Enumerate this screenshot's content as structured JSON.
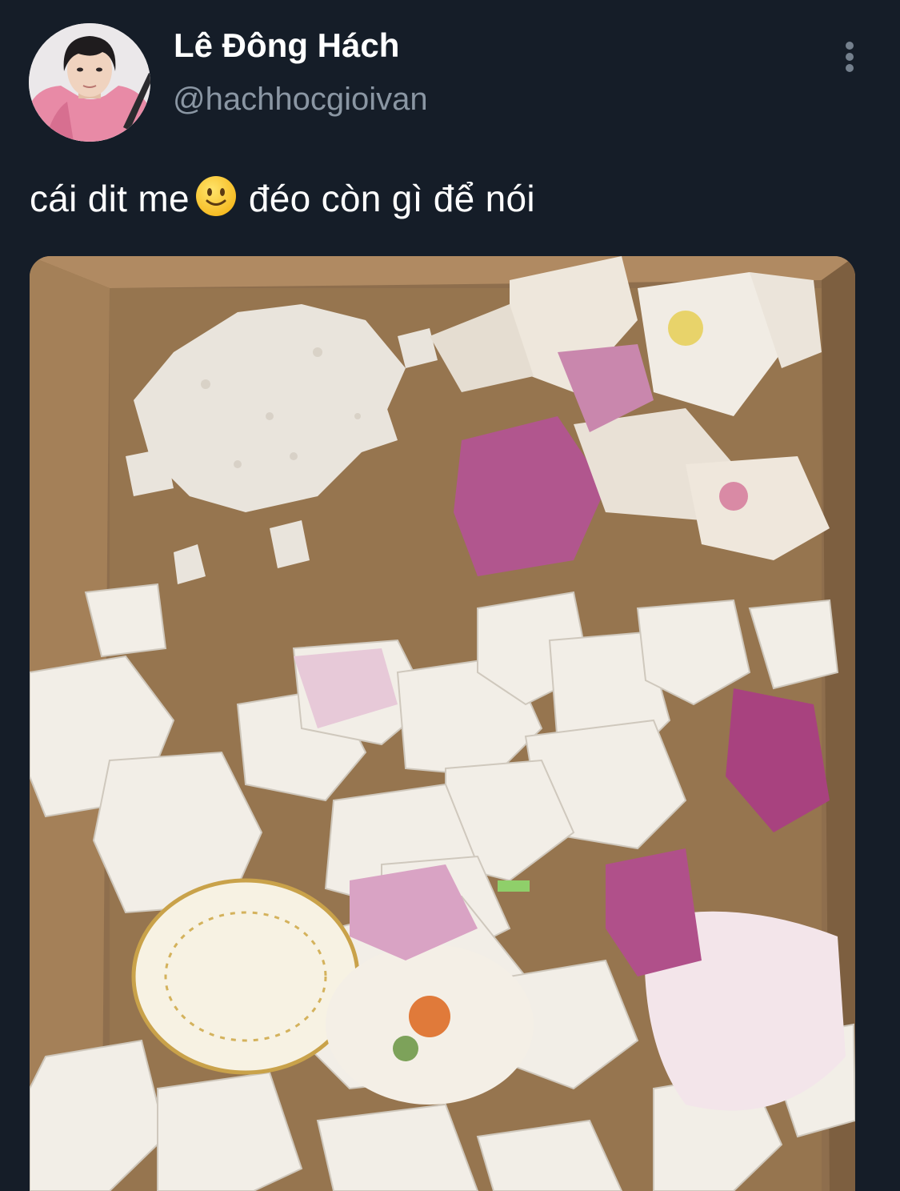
{
  "tweet": {
    "author": {
      "display_name": "Lê Đông Hách",
      "handle": "@hachhocgioivan",
      "avatar_icon": "profile-photo"
    },
    "menu_icon": "vertical-ellipsis-icon",
    "text_before_emoji": "cái dit me",
    "emoji": "slightly-smiling-face",
    "text_after_emoji": "đéo còn gì để nói",
    "media": {
      "type": "photo",
      "content": "broken porcelain pieces in a cardboard box"
    }
  },
  "colors": {
    "background": "#151d28",
    "name_text": "#ffffff",
    "handle_text": "#8a96a3",
    "menu_dots": "#74808d"
  }
}
